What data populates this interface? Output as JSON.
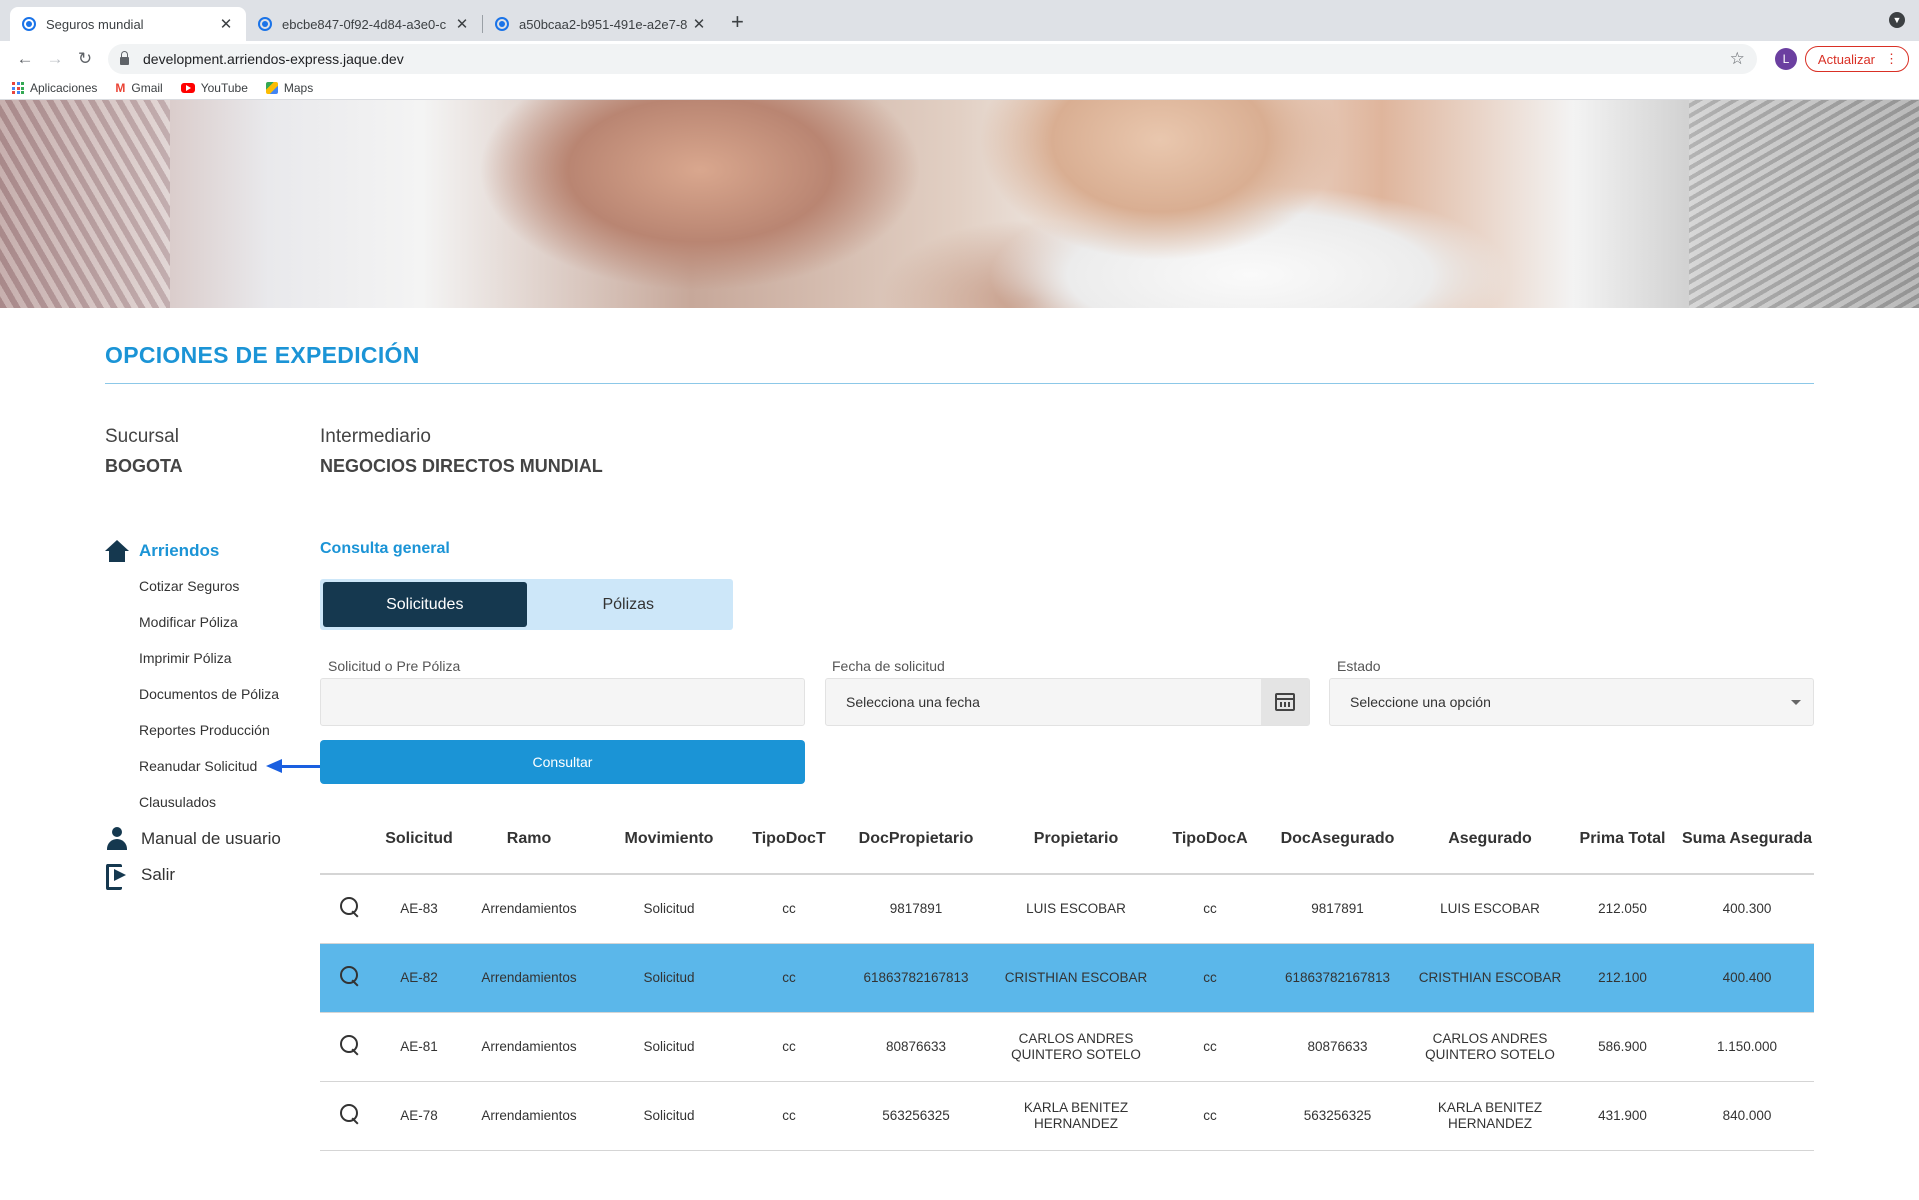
{
  "browser": {
    "tabs": [
      {
        "title": "Seguros mundial",
        "active": true
      },
      {
        "title": "ebcbe847-0f92-4d84-a3e0-c",
        "active": false
      },
      {
        "title": "a50bcaa2-b951-491e-a2e7-8",
        "active": false
      }
    ],
    "url": "development.arriendos-express.jaque.dev",
    "profile_initial": "L",
    "update_label": "Actualizar",
    "bookmarks": [
      "Aplicaciones",
      "Gmail",
      "YouTube",
      "Maps"
    ]
  },
  "page": {
    "section_title": "OPCIONES DE EXPEDICIÓN",
    "sucursal": {
      "label": "Sucursal",
      "value": "BOGOTA"
    },
    "intermediario": {
      "label": "Intermediario",
      "value": "NEGOCIOS DIRECTOS MUNDIAL"
    }
  },
  "sidebar": {
    "head": "Arriendos",
    "links": [
      "Cotizar Seguros",
      "Modificar Póliza",
      "Imprimir Póliza",
      "Documentos de Póliza",
      "Reportes Producción",
      "Reanudar Solicitud",
      "Clausulados"
    ],
    "manual": "Manual de usuario",
    "logout": "Salir"
  },
  "consulta": {
    "title": "Consulta general",
    "tabs": [
      "Solicitudes",
      "Pólizas"
    ],
    "active_tab": "Solicitudes",
    "solicitud_label": "Solicitud o Pre Póliza",
    "solicitud_value": "",
    "fecha_label": "Fecha de solicitud",
    "fecha_placeholder": "Selecciona una fecha",
    "estado_label": "Estado",
    "estado_value": "Seleccione una opción",
    "button": "Consultar"
  },
  "table": {
    "columns": [
      "Solicitud",
      "Ramo",
      "Movimiento",
      "TipoDocT",
      "DocPropietario",
      "Propietario",
      "TipoDocA",
      "DocAsegurado",
      "Asegurado",
      "Prima Total",
      "Suma Asegurada"
    ],
    "rows": [
      {
        "solicitud": "AE-83",
        "ramo": "Arrendamientos",
        "movimiento": "Solicitud",
        "tipodoct": "cc",
        "docprop": "9817891",
        "propietario": "LUIS ESCOBAR",
        "tipodoca": "cc",
        "docaseg": "9817891",
        "asegurado": "LUIS ESCOBAR",
        "prima": "212.050",
        "suma": "400.300",
        "selected": false
      },
      {
        "solicitud": "AE-82",
        "ramo": "Arrendamientos",
        "movimiento": "Solicitud",
        "tipodoct": "cc",
        "docprop": "61863782167813",
        "propietario": "CRISTHIAN ESCOBAR",
        "tipodoca": "cc",
        "docaseg": "61863782167813",
        "asegurado": "CRISTHIAN ESCOBAR",
        "prima": "212.100",
        "suma": "400.400",
        "selected": true
      },
      {
        "solicitud": "AE-81",
        "ramo": "Arrendamientos",
        "movimiento": "Solicitud",
        "tipodoct": "cc",
        "docprop": "80876633",
        "propietario": "CARLOS ANDRES QUINTERO SOTELO",
        "tipodoca": "cc",
        "docaseg": "80876633",
        "asegurado": "CARLOS ANDRES QUINTERO SOTELO",
        "prima": "586.900",
        "suma": "1.150.000",
        "selected": false
      },
      {
        "solicitud": "AE-78",
        "ramo": "Arrendamientos",
        "movimiento": "Solicitud",
        "tipodoct": "cc",
        "docprop": "563256325",
        "propietario": "KARLA BENITEZ HERNANDEZ",
        "tipodoca": "cc",
        "docaseg": "563256325",
        "asegurado": "KARLA BENITEZ HERNANDEZ",
        "prima": "431.900",
        "suma": "840.000",
        "selected": false
      }
    ]
  },
  "colors": {
    "accent": "#1b94d6",
    "dark": "#15384f",
    "selected_row": "#5bb7ea",
    "tab_bg": "#cde7f9"
  }
}
